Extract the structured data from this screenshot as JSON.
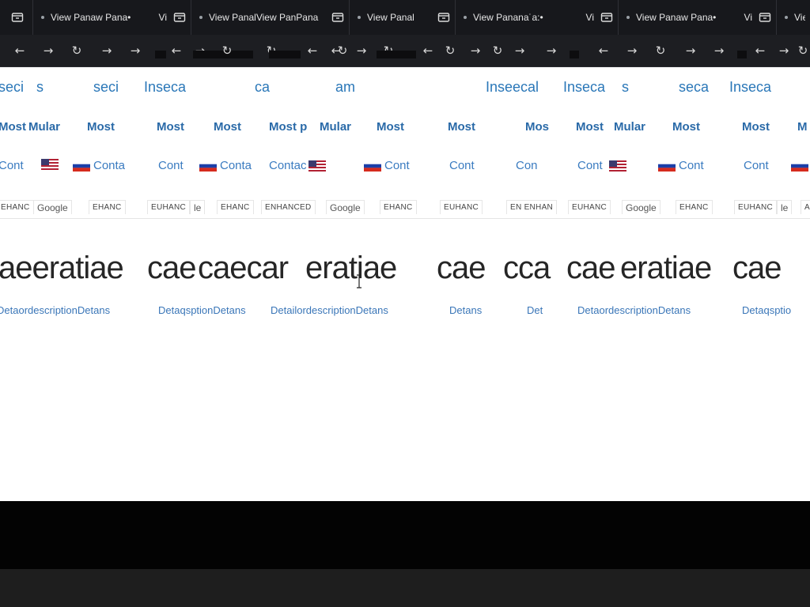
{
  "tabs": [
    {
      "label": "",
      "icon": "inbox-icon"
    },
    {
      "label": "View Panaw Pana•",
      "trailing": "Vi",
      "icon": "inbox-icon"
    },
    {
      "label": "View PanalView PanPana",
      "icon": "inbox-icon"
    },
    {
      "label": "View Panal",
      "icon": "inbox-icon"
    },
    {
      "label": "View Panana˙a:•",
      "trailing": "Vi",
      "icon": "inbox-icon"
    },
    {
      "label": "View Panaw Pana•",
      "trailing": "Vi",
      "icon": "inbox-icon"
    },
    {
      "label": "Vie",
      "icon": "inbox-icon"
    }
  ],
  "toolbar": {
    "icons": [
      "back-arrow-icon",
      "forward-arrow-icon",
      "reload-icon"
    ],
    "glyphs": {
      "back": "←",
      "forward": "→",
      "reload": "↻"
    }
  },
  "content": {
    "security_row": [
      "seci",
      "s",
      "seci",
      "Inseca",
      "ca",
      "am",
      "Inseecal",
      "Inseca",
      "s",
      "seca",
      "Inseca"
    ],
    "most_row": [
      "Most",
      "Mular",
      "Most",
      "Most",
      "Most",
      "Most p",
      "Mular",
      "Most",
      "Most",
      "Mos",
      "Most",
      "Mular",
      "Most",
      "Most",
      "M"
    ],
    "contact_row": [
      "Cont",
      "Conta",
      "Cont",
      "Conta",
      "Contac",
      "Cont",
      "Cont",
      "Con",
      "Cont",
      "Cont",
      "Cont"
    ],
    "badges": [
      "EHANC",
      "Google",
      "EHANC",
      "EUHANC",
      "le",
      "EHANC",
      "ENHANCED",
      "Google",
      "EHANC",
      "EUHANC",
      "EN ENHAN",
      "EUHANC",
      "Google",
      "EHANC",
      "EUHANC",
      "le",
      "A"
    ],
    "heading_fragments": [
      "aeeratiae",
      "cae",
      "caecar",
      "eratiae",
      "cae",
      "cca",
      "cae",
      "eratiae",
      "cae",
      "cae"
    ],
    "detail_fragments": [
      "DetaordescriptionDetans",
      "DetaqsptionDetans",
      "DetailordescriptionDetans",
      "Detans",
      "Det",
      "DetaordescriptionDetans",
      "Detaqsptio"
    ]
  },
  "colors": {
    "tabbar": "#17181c",
    "toolbar": "#1d1e22",
    "link_blue": "#2a77b8",
    "heading": "#262626",
    "bottom_black": "#030303",
    "statusbar": "#1e1e1e"
  }
}
